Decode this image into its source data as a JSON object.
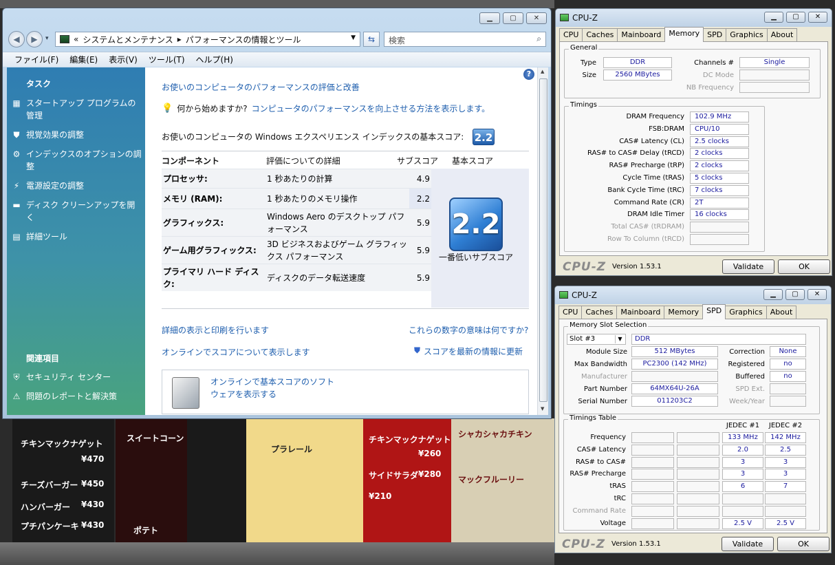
{
  "background": {
    "menu_items": [
      "チキンマックナゲット",
      "スイートコーン",
      "チキンマックナゲット",
      "シャカシャカチキン",
      "チーズバーガー",
      "ハンバーガー",
      "プチパンケーキ",
      "サイドサラダ",
      "マックフルーリー",
      "ポテト",
      "¥470",
      "¥450",
      "¥430",
      "¥430",
      "¥260",
      "¥280",
      "¥210",
      "プラレール"
    ]
  },
  "explorer": {
    "breadcrumb_root": "«",
    "breadcrumb_1": "システムとメンテナンス",
    "breadcrumb_sep": "▸",
    "breadcrumb_2": "パフォーマンスの情報とツール",
    "search_placeholder": "検索",
    "title_buttons": {
      "minimize": "▁",
      "maximize": "▢",
      "close": "✕"
    },
    "menu": [
      "ファイル(F)",
      "編集(E)",
      "表示(V)",
      "ツール(T)",
      "ヘルプ(H)"
    ],
    "sidebar": {
      "heading": "タスク",
      "items": [
        {
          "label": "スタートアップ プログラムの管理",
          "icon": "startup-icon"
        },
        {
          "label": "視覚効果の調整",
          "icon": "shield-icon"
        },
        {
          "label": "インデックスのオプションの調整",
          "icon": "index-icon"
        },
        {
          "label": "電源設定の調整",
          "icon": "power-icon"
        },
        {
          "label": "ディスク クリーンアップを開く",
          "icon": "disk-cleanup-icon"
        },
        {
          "label": "詳細ツール",
          "icon": "tools-icon"
        }
      ],
      "related_heading": "関連項目",
      "related": [
        {
          "label": "セキュリティ センター",
          "icon": "security-shield-icon"
        },
        {
          "label": "問題のレポートと解決策",
          "icon": "report-icon"
        }
      ]
    },
    "main": {
      "title_link": "お使いのコンピュータのパフォーマンスの評価と改善",
      "tip_prefix": "何から始めますか?",
      "tip_link": "コンピュータのパフォーマンスを向上させる方法を表示します。",
      "base_score_label": "お使いのコンピュータの Windows エクスペリエンス インデックスの基本スコア:",
      "base_score": "2.2",
      "headers": {
        "component": "コンポーネント",
        "detail": "評価についての詳細",
        "subscore": "サブスコア",
        "basescore": "基本スコア"
      },
      "rows": [
        {
          "component": "プロセッサ:",
          "detail": "1 秒あたりの計算",
          "score": "4.9"
        },
        {
          "component": "メモリ (RAM):",
          "detail": "1 秒あたりのメモリ操作",
          "score": "2.2"
        },
        {
          "component": "グラフィックス:",
          "detail": "Windows Aero のデスクトップ パフォーマンス",
          "score": "5.9"
        },
        {
          "component": "ゲーム用グラフィックス:",
          "detail": "3D ビジネスおよびゲーム グラフィックス パフォーマンス",
          "score": "5.9"
        },
        {
          "component": "プライマリ ハード ディスク:",
          "detail": "ディスクのデータ転送速度",
          "score": "5.9"
        }
      ],
      "big_score": "2.2",
      "big_caption": "一番低いサブスコア",
      "link_print": "詳細の表示と印刷を行います",
      "link_meaning": "これらの数字の意味は何ですか?",
      "link_online": "オンラインでスコアについて表示します",
      "link_refresh": "スコアを最新の情報に更新",
      "promo": "オンラインで基本スコアのソフトウェアを表示する"
    }
  },
  "cpuz_memory": {
    "title": "CPU-Z",
    "tabs": [
      "CPU",
      "Caches",
      "Mainboard",
      "Memory",
      "SPD",
      "Graphics",
      "About"
    ],
    "active_tab": "Memory",
    "general_title": "General",
    "type_label": "Type",
    "type": "DDR",
    "size_label": "Size",
    "size": "2560 MBytes",
    "channels_label": "Channels #",
    "channels": "Single",
    "dcmode_label": "DC Mode",
    "nbfreq_label": "NB Frequency",
    "timings_title": "Timings",
    "timings": [
      {
        "label": "DRAM Frequency",
        "value": "102.9 MHz"
      },
      {
        "label": "FSB:DRAM",
        "value": "CPU/10"
      },
      {
        "label": "CAS# Latency (CL)",
        "value": "2.5 clocks"
      },
      {
        "label": "RAS# to CAS# Delay (tRCD)",
        "value": "2 clocks"
      },
      {
        "label": "RAS# Precharge (tRP)",
        "value": "2 clocks"
      },
      {
        "label": "Cycle Time (tRAS)",
        "value": "5 clocks"
      },
      {
        "label": "Bank Cycle Time (tRC)",
        "value": "7 clocks"
      },
      {
        "label": "Command Rate (CR)",
        "value": "2T"
      },
      {
        "label": "DRAM Idle Timer",
        "value": "16 clocks"
      },
      {
        "label": "Total CAS# (tRDRAM)",
        "value": ""
      },
      {
        "label": "Row To Column (tRCD)",
        "value": ""
      }
    ],
    "logo": "CPU-Z",
    "version": "Version 1.53.1",
    "validate": "Validate",
    "ok": "OK"
  },
  "cpuz_spd": {
    "title": "CPU-Z",
    "tabs": [
      "CPU",
      "Caches",
      "Mainboard",
      "Memory",
      "SPD",
      "Graphics",
      "About"
    ],
    "active_tab": "SPD",
    "slot_title": "Memory Slot Selection",
    "slot": "Slot #3",
    "mem_type": "DDR",
    "module_size_label": "Module Size",
    "module_size": "512 MBytes",
    "max_bw_label": "Max Bandwidth",
    "max_bw": "PC2300 (142 MHz)",
    "manufacturer_label": "Manufacturer",
    "part_label": "Part Number",
    "part": "64MX64U-26A",
    "serial_label": "Serial Number",
    "serial": "011203C2",
    "correction_label": "Correction",
    "correction": "None",
    "registered_label": "Registered",
    "registered": "no",
    "buffered_label": "Buffered",
    "buffered": "no",
    "spdext_label": "SPD Ext.",
    "weekyear_label": "Week/Year",
    "timings_title": "Timings Table",
    "col1": "JEDEC #1",
    "col2": "JEDEC #2",
    "rows": [
      {
        "label": "Frequency",
        "v1": "133 MHz",
        "v2": "142 MHz"
      },
      {
        "label": "CAS# Latency",
        "v1": "2.0",
        "v2": "2.5"
      },
      {
        "label": "RAS# to CAS#",
        "v1": "3",
        "v2": "3"
      },
      {
        "label": "RAS# Precharge",
        "v1": "3",
        "v2": "3"
      },
      {
        "label": "tRAS",
        "v1": "6",
        "v2": "7"
      },
      {
        "label": "tRC",
        "v1": "",
        "v2": ""
      },
      {
        "label": "Command Rate",
        "v1": "",
        "v2": ""
      },
      {
        "label": "Voltage",
        "v1": "2.5 V",
        "v2": "2.5 V"
      }
    ],
    "logo": "CPU-Z",
    "version": "Version 1.53.1",
    "validate": "Validate",
    "ok": "OK"
  }
}
